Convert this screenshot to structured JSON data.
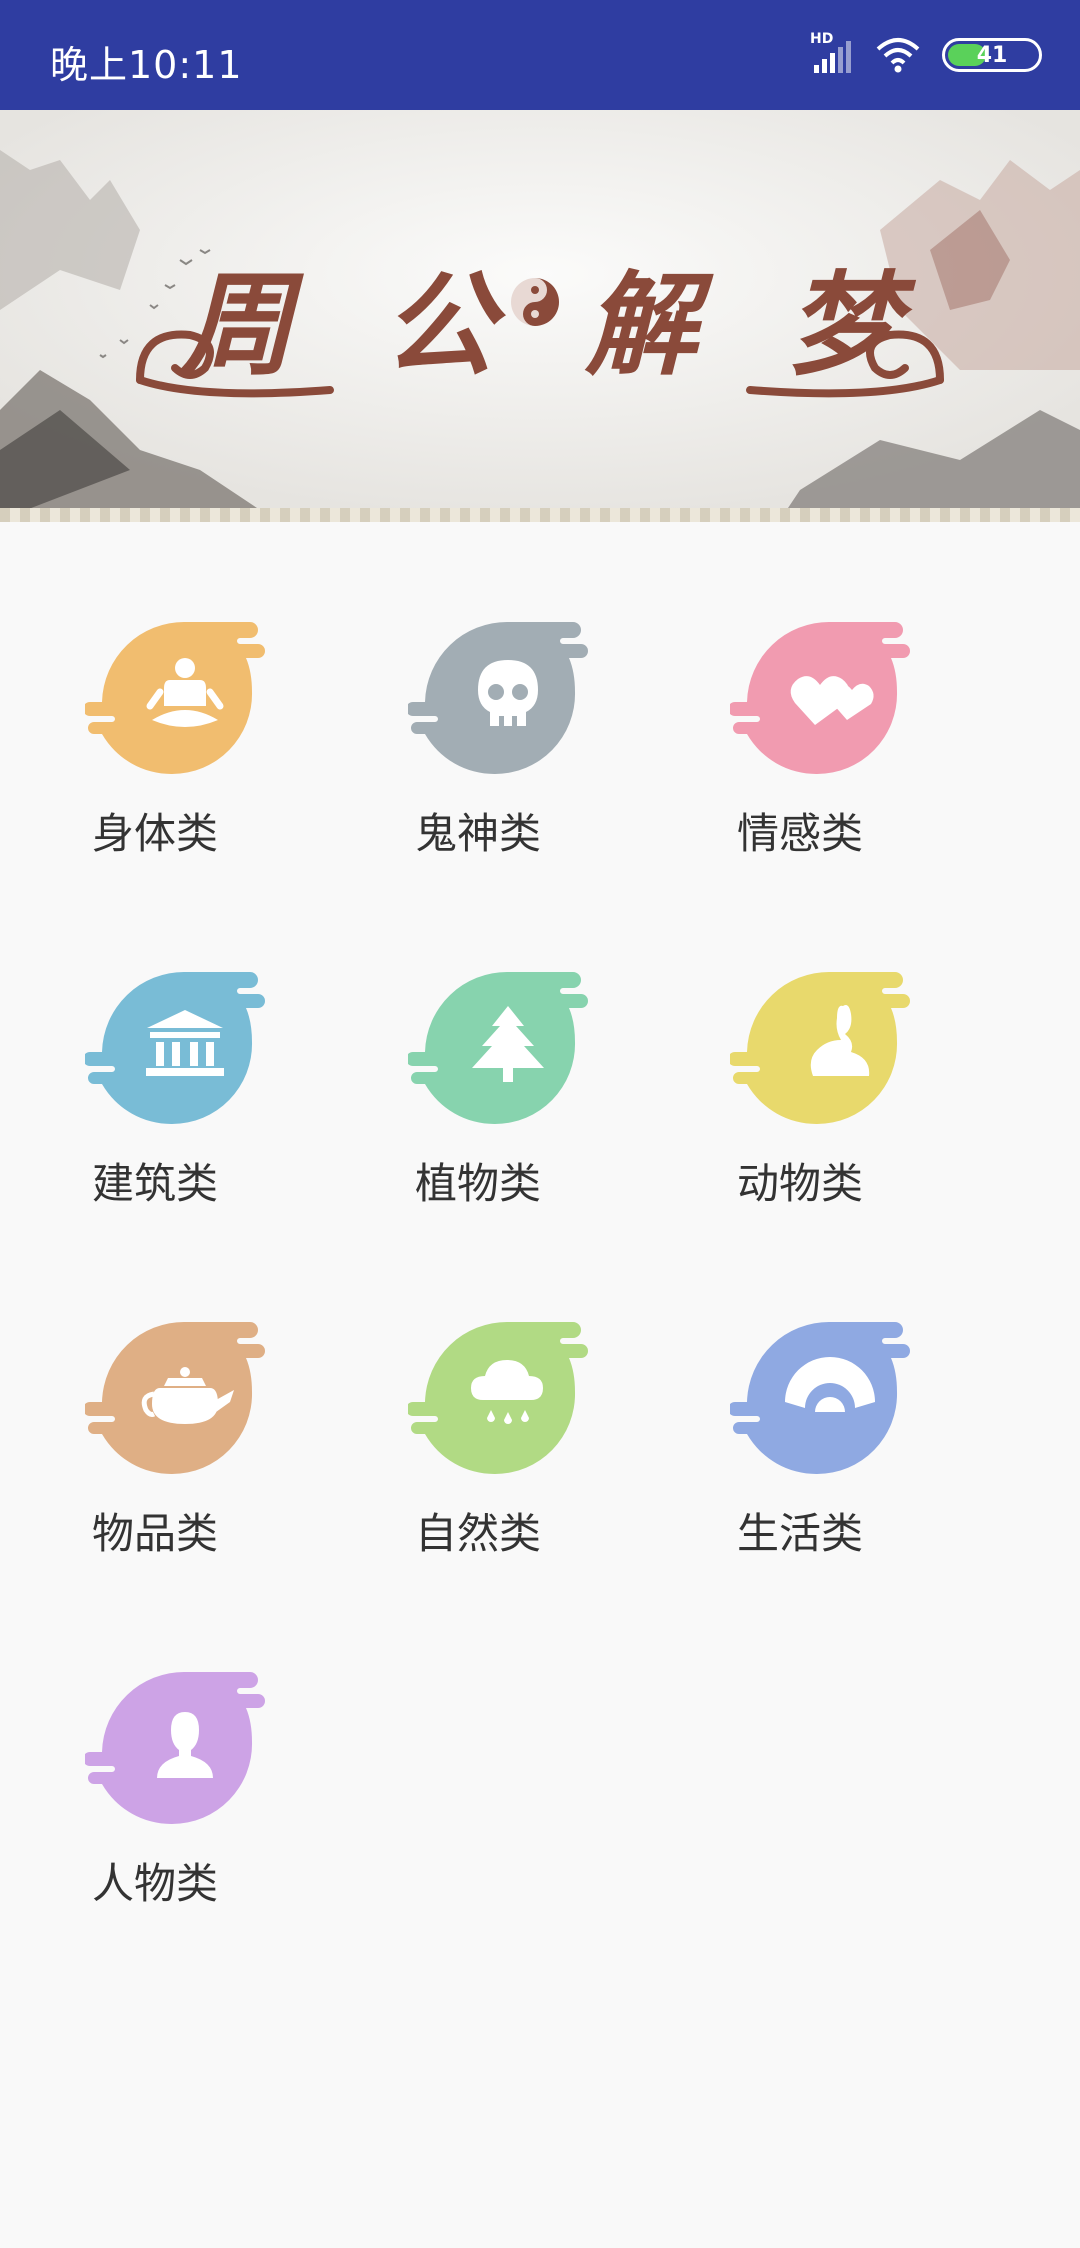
{
  "status_bar": {
    "time": "晚上10:11",
    "network_label": "HD",
    "battery_level": "41",
    "background_color": "#2f3da1"
  },
  "banner": {
    "title": "周公解梦",
    "icon": "yin-yang-icon",
    "title_color": "#8a4a3a"
  },
  "categories": [
    {
      "label": "身体类",
      "icon": "meditation-person-icon",
      "color": "#f1bd6f"
    },
    {
      "label": "鬼神类",
      "icon": "skull-icon",
      "color": "#a2adb4"
    },
    {
      "label": "情感类",
      "icon": "hearts-icon",
      "color": "#f19bb0"
    },
    {
      "label": "建筑类",
      "icon": "temple-building-icon",
      "color": "#79bcd6"
    },
    {
      "label": "植物类",
      "icon": "pine-tree-icon",
      "color": "#87d3ae"
    },
    {
      "label": "动物类",
      "icon": "rabbit-icon",
      "color": "#e8d96c"
    },
    {
      "label": "物品类",
      "icon": "teapot-icon",
      "color": "#dfaf85"
    },
    {
      "label": "自然类",
      "icon": "rain-cloud-icon",
      "color": "#b1da84"
    },
    {
      "label": "生活类",
      "icon": "folding-fan-icon",
      "color": "#8fa9e2"
    },
    {
      "label": "人物类",
      "icon": "person-silhouette-icon",
      "color": "#cda3e6"
    }
  ]
}
